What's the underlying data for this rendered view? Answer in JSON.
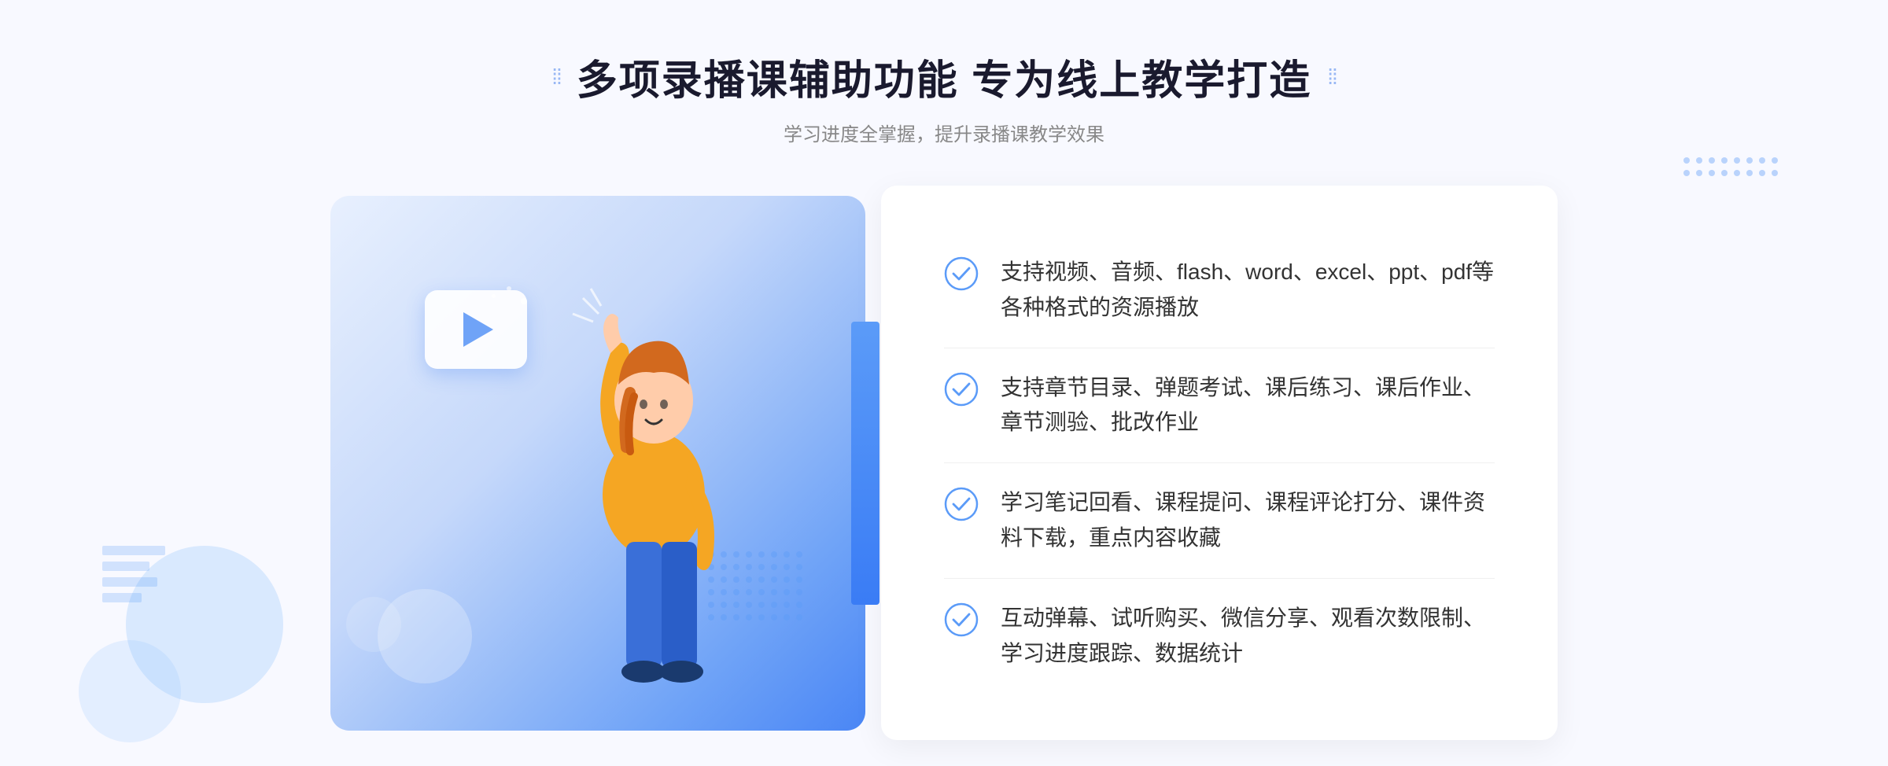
{
  "header": {
    "deco_left": "⁞⁞",
    "deco_right": "⁞⁞",
    "title": "多项录播课辅助功能 专为线上教学打造",
    "subtitle": "学习进度全掌握，提升录播课教学效果"
  },
  "features": [
    {
      "id": "feature-1",
      "text": "支持视频、音频、flash、word、excel、ppt、pdf等各种格式的资源播放"
    },
    {
      "id": "feature-2",
      "text": "支持章节目录、弹题考试、课后练习、课后作业、章节测验、批改作业"
    },
    {
      "id": "feature-3",
      "text": "学习笔记回看、课程提问、课程评论打分、课件资料下载，重点内容收藏"
    },
    {
      "id": "feature-4",
      "text": "互动弹幕、试听购买、微信分享、观看次数限制、学习进度跟踪、数据统计"
    }
  ],
  "colors": {
    "primary": "#4a86f5",
    "light_blue": "#6fa3f7",
    "text_dark": "#1a1a2e",
    "text_gray": "#888888",
    "text_body": "#333333",
    "check_color": "#5b9bf8",
    "bg_page": "#f8f9ff"
  },
  "icons": {
    "check": "✓",
    "arrow_left": "»",
    "play": "▶"
  }
}
